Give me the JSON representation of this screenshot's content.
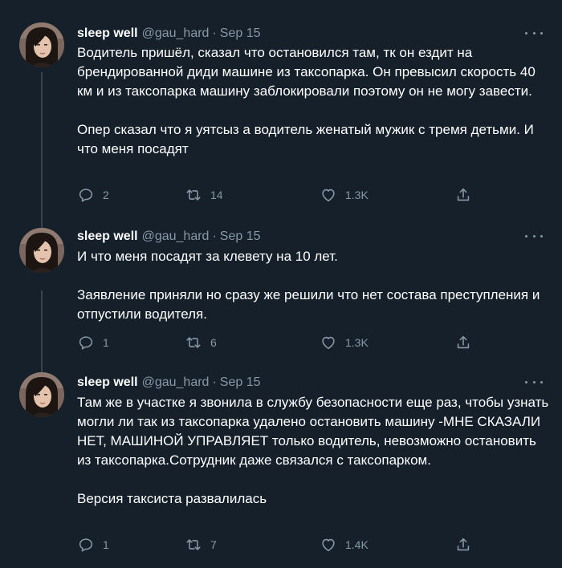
{
  "colors": {
    "background": "#15202b",
    "text": "#ffffff",
    "secondary": "#8899a6",
    "border": "#38444d"
  },
  "tweets": [
    {
      "name": "sleep well",
      "handle": "@gau_hard",
      "sep": "·",
      "date": "Sep 15",
      "paragraphs": [
        "Водитель пришёл, сказал что остановился там, тк он ездит на брендированной диди машине из таксопарка. Он превысил скорость 40 км и из таксопарка машину заблокировали поэтому он не могу завести.",
        "Опер сказал что я уятсыз а водитель женатый мужик с тремя детьми. И что меня посадят"
      ],
      "replies": "2",
      "retweets": "14",
      "likes": "1.3K",
      "icons": [
        "more-icon",
        "reply-icon",
        "retweet-icon",
        "like-icon",
        "share-icon"
      ]
    },
    {
      "name": "sleep well",
      "handle": "@gau_hard",
      "sep": "·",
      "date": "Sep 15",
      "paragraphs": [
        "И что меня посадят за клевету на 10 лет.",
        "Заявление приняли но сразу же решили что нет состава преступления и отпустили водителя."
      ],
      "replies": "1",
      "retweets": "6",
      "likes": "1.3K",
      "icons": [
        "more-icon",
        "reply-icon",
        "retweet-icon",
        "like-icon",
        "share-icon"
      ]
    },
    {
      "name": "sleep well",
      "handle": "@gau_hard",
      "sep": "·",
      "date": "Sep 15",
      "paragraphs": [
        "Там же в участке я звонила в службу безопасности еще раз, чтобы узнать могли ли так из таксопарка удалено остановить машину -МНЕ СКАЗАЛИ НЕТ, МАШИНОЙ УПРАВЛЯЕТ только водитель, невозможно остановить из таксопарка.Сотрудник даже связался с таксопарком.",
        "Версия таксиста развалилась"
      ],
      "replies": "1",
      "retweets": "7",
      "likes": "1.4K",
      "icons": [
        "more-icon",
        "reply-icon",
        "retweet-icon",
        "like-icon",
        "share-icon"
      ]
    }
  ]
}
